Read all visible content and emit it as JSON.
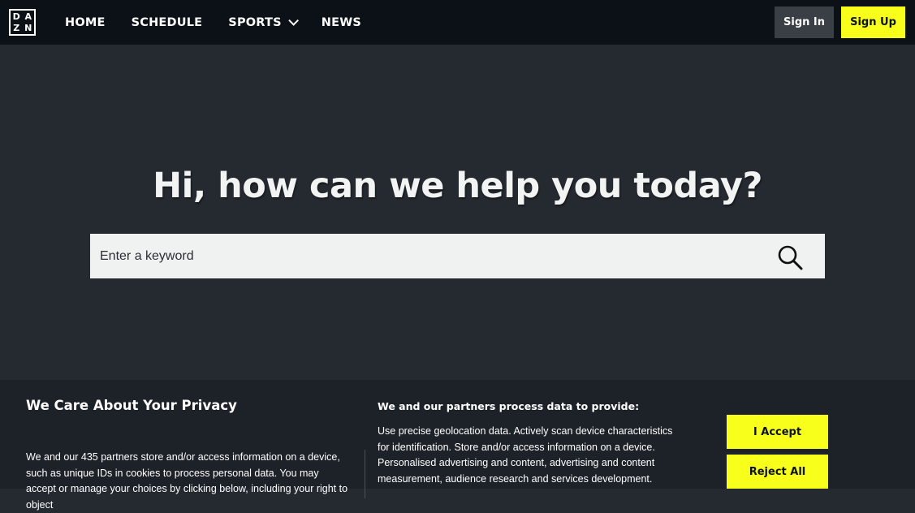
{
  "logo": {
    "letters": [
      "D",
      "A",
      "Z",
      "N"
    ]
  },
  "nav": {
    "items": [
      {
        "label": "HOME"
      },
      {
        "label": "SCHEDULE"
      },
      {
        "label": "SPORTS"
      },
      {
        "label": "NEWS"
      }
    ],
    "sign_in": "Sign In",
    "sign_up": "Sign Up"
  },
  "hero": {
    "title": "Hi, how can we help you today?",
    "search_placeholder": "Enter a keyword"
  },
  "cookie": {
    "title": "We Care About Your Privacy",
    "body": "We and our 435 partners store and/or access information on a device, such as unique IDs in cookies to process personal data. You may accept or manage your choices by clicking below, including your right to object",
    "purposes_title": "We and our partners process data to provide:",
    "purposes_body": "Use precise geolocation data. Actively scan device characteristics for identification. Store and/or access information on a device. Personalised advertising and content, advertising and content measurement, audience research and services development.",
    "accept_label": "I Accept",
    "reject_label": "Reject All"
  },
  "colors": {
    "brand_yellow": "#f7ff1a",
    "nav_bg": "#0c1117",
    "page_bg": "#252a31"
  }
}
